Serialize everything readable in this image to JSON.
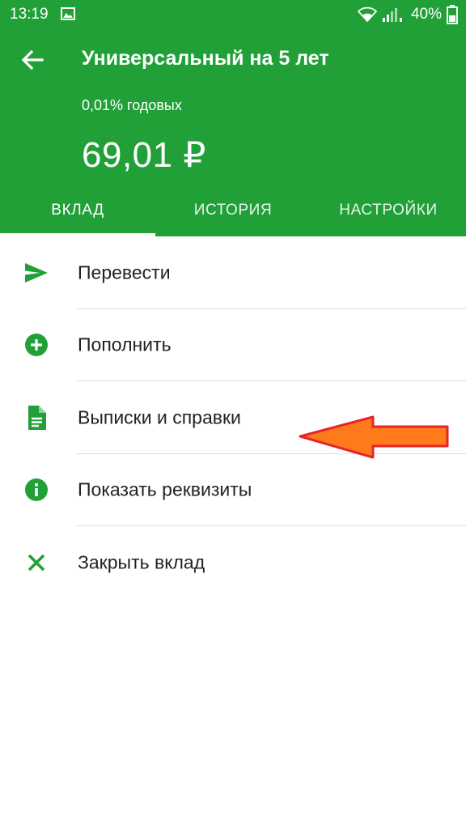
{
  "status_bar": {
    "time": "13:19",
    "battery": "40%"
  },
  "header": {
    "title": "Универсальный на 5 лет",
    "rate": "0,01% годовых",
    "balance": "69,01 ₽",
    "background_color": "#21a038"
  },
  "tabs": [
    {
      "label": "ВКЛАД",
      "active": true
    },
    {
      "label": "ИСТОРИЯ",
      "active": false
    },
    {
      "label": "НАСТРОЙКИ",
      "active": false
    }
  ],
  "menu": {
    "icon_color": "#21a038",
    "items": [
      {
        "label": "Перевести",
        "icon": "send-icon"
      },
      {
        "label": "Пополнить",
        "icon": "plus-circle-icon"
      },
      {
        "label": "Выписки и справки",
        "icon": "document-icon"
      },
      {
        "label": "Показать реквизиты",
        "icon": "info-icon"
      },
      {
        "label": "Закрыть вклад",
        "icon": "close-icon"
      }
    ]
  },
  "annotation": {
    "arrow_color": "#ff7a1a",
    "arrow_outline": "#e8232a",
    "points_to": "Выписки и справки"
  }
}
